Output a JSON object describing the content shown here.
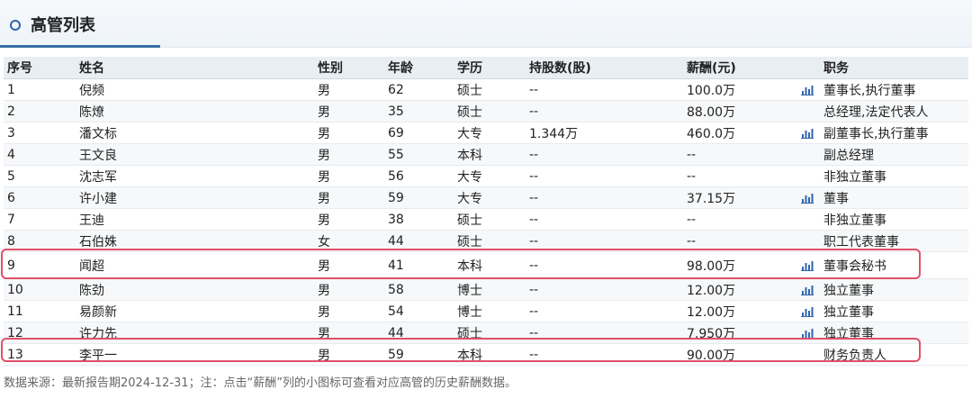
{
  "header": {
    "title": "高管列表"
  },
  "table": {
    "columns": [
      "序号",
      "姓名",
      "性别",
      "年龄",
      "学历",
      "持股数(股)",
      "薪酬(元)",
      "职务"
    ],
    "rows": [
      {
        "no": "1",
        "name": "倪频",
        "gender": "男",
        "age": "62",
        "edu": "硕士",
        "shares": "--",
        "salary": "100.0万",
        "chart": true,
        "title": "董事长,执行董事"
      },
      {
        "no": "2",
        "name": "陈燎",
        "gender": "男",
        "age": "35",
        "edu": "硕士",
        "shares": "--",
        "salary": "88.00万",
        "chart": false,
        "title": "总经理,法定代表人"
      },
      {
        "no": "3",
        "name": "潘文标",
        "gender": "男",
        "age": "69",
        "edu": "大专",
        "shares": "1.344万",
        "salary": "460.0万",
        "chart": true,
        "title": "副董事长,执行董事"
      },
      {
        "no": "4",
        "name": "王文良",
        "gender": "男",
        "age": "55",
        "edu": "本科",
        "shares": "--",
        "salary": "--",
        "chart": false,
        "title": "副总经理"
      },
      {
        "no": "5",
        "name": "沈志军",
        "gender": "男",
        "age": "56",
        "edu": "大专",
        "shares": "--",
        "salary": "--",
        "chart": false,
        "title": "非独立董事"
      },
      {
        "no": "6",
        "name": "许小建",
        "gender": "男",
        "age": "59",
        "edu": "大专",
        "shares": "--",
        "salary": "37.15万",
        "chart": true,
        "title": "董事"
      },
      {
        "no": "7",
        "name": "王迪",
        "gender": "男",
        "age": "38",
        "edu": "硕士",
        "shares": "--",
        "salary": "--",
        "chart": false,
        "title": "非独立董事"
      },
      {
        "no": "8",
        "name": "石伯姝",
        "gender": "女",
        "age": "44",
        "edu": "硕士",
        "shares": "--",
        "salary": "--",
        "chart": false,
        "title": "职工代表董事"
      },
      {
        "no": "9",
        "name": "闻超",
        "gender": "男",
        "age": "41",
        "edu": "本科",
        "shares": "--",
        "salary": "98.00万",
        "chart": true,
        "title": "董事会秘书"
      },
      {
        "no": "10",
        "name": "陈劲",
        "gender": "男",
        "age": "58",
        "edu": "博士",
        "shares": "--",
        "salary": "12.00万",
        "chart": true,
        "title": "独立董事"
      },
      {
        "no": "11",
        "name": "易颜新",
        "gender": "男",
        "age": "54",
        "edu": "博士",
        "shares": "--",
        "salary": "12.00万",
        "chart": true,
        "title": "独立董事"
      },
      {
        "no": "12",
        "name": "许力先",
        "gender": "男",
        "age": "44",
        "edu": "硕士",
        "shares": "--",
        "salary": "7.950万",
        "chart": true,
        "title": "独立董事"
      },
      {
        "no": "13",
        "name": "李平一",
        "gender": "男",
        "age": "59",
        "edu": "本科",
        "shares": "--",
        "salary": "90.00万",
        "chart": false,
        "title": "财务负责人"
      }
    ]
  },
  "footnote": "数据来源：最新报告期2024-12-31；注：点击“薪酬”列的小图标可查看对应高管的历史薪酬数据。",
  "colors": {
    "accent": "#3a6ea5",
    "icon": "#2f64b0",
    "highlight": "#e0506a"
  }
}
